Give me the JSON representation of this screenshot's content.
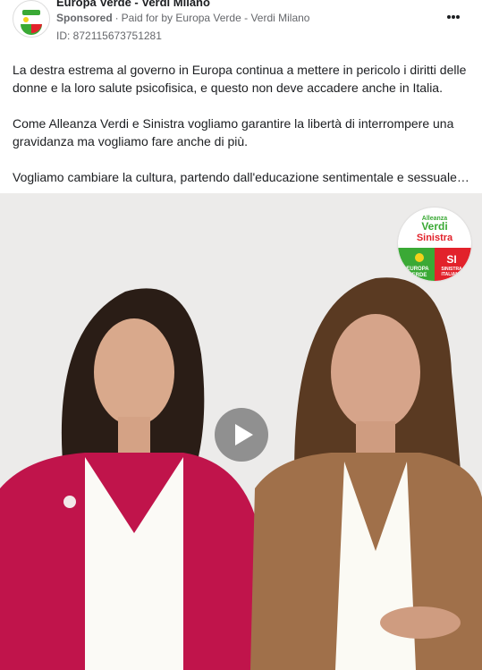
{
  "post": {
    "page_name": "Europa Verde - Verdi Milano",
    "sponsored": "Sponsored",
    "paid_for_prefix": "Paid for by",
    "payer": "Europa Verde - Verdi Milano",
    "ad_id": "ID: 872115673751281",
    "more_icon": "more-horizontal-icon",
    "paragraphs": [
      "La destra estrema al governo in Europa continua a mettere in pericolo i diritti delle donne e la loro salute psicofisica, e questo non deve accadere anche in Italia.",
      "Come Alleanza Verdi e Sinistra vogliamo garantire la libertà di interrompere una gravidanza ma vogliamo fare anche di più.",
      "Vogliamo cambiare la cultura, partendo dall'educazione sentimentale e sessuale…"
    ]
  },
  "video": {
    "play_icon": "play-icon",
    "logo": {
      "line1": "Alleanza",
      "line2": "Verdi",
      "line3": "Sinistra",
      "left_text1": "EUROPA",
      "left_text2": "VERDE",
      "right_text1": "SI",
      "right_text2": "SINISTRA",
      "right_text3": "ITALIANA"
    }
  },
  "colors": {
    "green": "#3aa935",
    "red": "#e2222b",
    "yellow": "#f4d21b",
    "magenta_jacket": "#c0144b",
    "tan_jacket": "#a0704a"
  }
}
